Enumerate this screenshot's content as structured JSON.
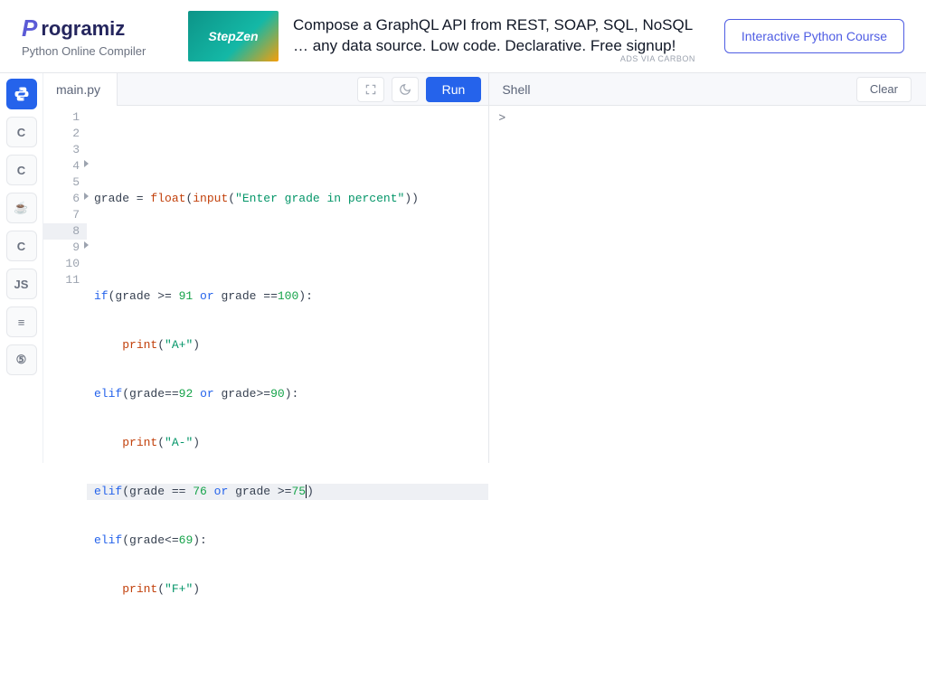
{
  "brand": {
    "logo_prefix": "P",
    "logo_rest": "rogramiz",
    "subtitle": "Python Online Compiler"
  },
  "ad": {
    "banner_text": "StepZen",
    "line1": "Compose a GraphQL API from REST, SOAP, SQL, NoSQL",
    "line2": "… any data source. Low code. Declarative. Free signup!",
    "disclaimer": "ADS VIA CARBON"
  },
  "course_button": "Interactive Python Course",
  "languages": [
    {
      "id": "python",
      "glyph": "py",
      "active": true
    },
    {
      "id": "c",
      "glyph": "C"
    },
    {
      "id": "cpp",
      "glyph": "C"
    },
    {
      "id": "java",
      "glyph": "☕"
    },
    {
      "id": "csharp",
      "glyph": "C"
    },
    {
      "id": "js",
      "glyph": "JS"
    },
    {
      "id": "sql",
      "glyph": "≡"
    },
    {
      "id": "html",
      "glyph": "⑤"
    }
  ],
  "editor": {
    "filename": "main.py",
    "run_label": "Run",
    "lines": [
      {
        "n": 1,
        "fold": false,
        "hl": false
      },
      {
        "n": 2,
        "fold": false,
        "hl": false
      },
      {
        "n": 3,
        "fold": false,
        "hl": false
      },
      {
        "n": 4,
        "fold": true,
        "hl": false
      },
      {
        "n": 5,
        "fold": false,
        "hl": false
      },
      {
        "n": 6,
        "fold": true,
        "hl": false
      },
      {
        "n": 7,
        "fold": false,
        "hl": false
      },
      {
        "n": 8,
        "fold": false,
        "hl": true
      },
      {
        "n": 9,
        "fold": true,
        "hl": false
      },
      {
        "n": 10,
        "fold": false,
        "hl": false
      },
      {
        "n": 11,
        "fold": false,
        "hl": false
      }
    ],
    "code": {
      "l1": "",
      "l2_a": "grade = ",
      "l2_fn": "float",
      "l2_b": "(",
      "l2_fn2": "input",
      "l2_c": "(",
      "l2_str": "\"Enter grade in percent\"",
      "l2_d": "))",
      "l3": "",
      "l4_kw": "if",
      "l4_rest": "(grade >= ",
      "l4_n1": "91",
      "l4_mid": " ",
      "l4_or": "or",
      "l4_mid2": " grade ==",
      "l4_n2": "100",
      "l4_end": "):",
      "l5_pad": "    ",
      "l5_fn": "print",
      "l5_a": "(",
      "l5_str": "\"A+\"",
      "l5_b": ")",
      "l6_kw": "elif",
      "l6_a": "(grade==",
      "l6_n1": "92",
      "l6_mid": " ",
      "l6_or": "or",
      "l6_b": " grade>=",
      "l6_n2": "90",
      "l6_end": "):",
      "l7_pad": "    ",
      "l7_fn": "print",
      "l7_a": "(",
      "l7_str": "\"A-\"",
      "l7_b": ")",
      "l8_kw": "elif",
      "l8_a": "(grade == ",
      "l8_n1": "76",
      "l8_mid": " ",
      "l8_or": "or",
      "l8_b": " grade >=",
      "l8_n2": "75",
      "l8_end": ")",
      "l9_kw": "elif",
      "l9_a": "(grade<=",
      "l9_n1": "69",
      "l9_end": "):",
      "l10_pad": "    ",
      "l10_fn": "print",
      "l10_a": "(",
      "l10_str": "\"F+\"",
      "l10_b": ")",
      "l11": ""
    }
  },
  "shell": {
    "title": "Shell",
    "clear_label": "Clear",
    "prompt": ">"
  }
}
